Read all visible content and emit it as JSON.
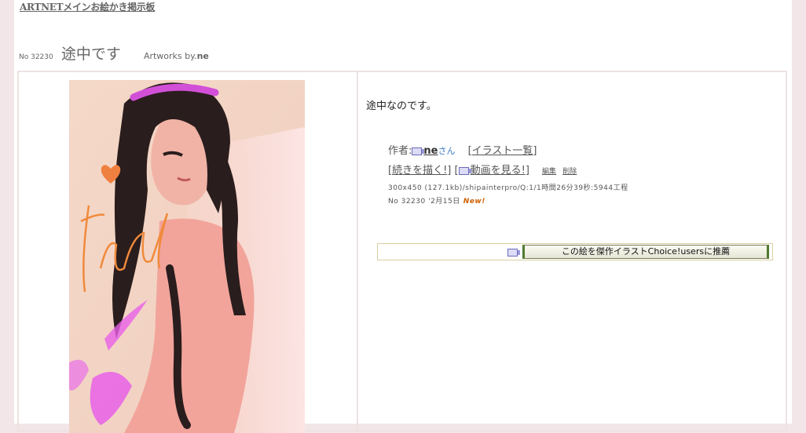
{
  "header": {
    "board_link": "ARTNETメインお絵かき掲示板"
  },
  "post": {
    "no_label": "No 32230",
    "title": "途中です",
    "artworks_by": "Artworks by.",
    "author": "ne",
    "comment": "途中なのです。"
  },
  "info": {
    "author_label": "作者:",
    "author_name": "ne",
    "san": "さん",
    "illust_list": "[イラスト一覧]",
    "bracket_open": "[",
    "bracket_close": "]",
    "continue_draw": "続きを描く!",
    "watch_video": "動画を見る!",
    "edit": "編集",
    "delete": "削除",
    "meta_line": "300x450 (127.1kb)/shipainterpro/Q:1/1時間26分39秒:5944工程",
    "date_line": "No 32230 '2月15日",
    "new_badge": "New!"
  },
  "recommend": {
    "button_label": "この絵を傑作イラストChoice!usersに推薦"
  },
  "icons": {
    "video": "video-icon"
  },
  "colors": {
    "background": "#f3e6e8",
    "frame_border": "#eee2e2",
    "new_badge": "#d06000",
    "san": "#3b7dc4"
  }
}
